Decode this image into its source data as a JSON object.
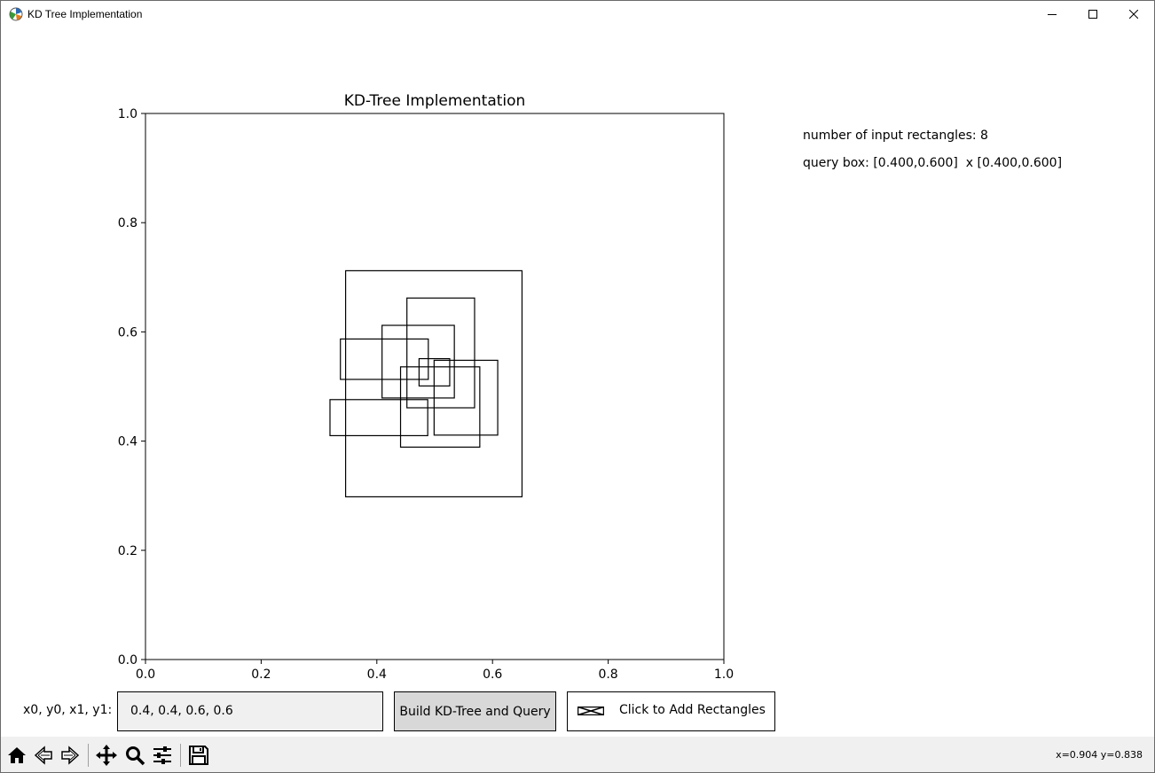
{
  "window": {
    "title": "KD Tree Implementation"
  },
  "info": {
    "num_rects": "number of input rectangles: 8",
    "query_box": "query box: [0.400,0.600]  x [0.400,0.600]"
  },
  "widgets": {
    "input_label": "x0, y0, x1, y1:",
    "input_value": "0.4, 0.4, 0.6, 0.6",
    "build_button": "Build KD-Tree and Query",
    "check_label": "Click to Add Rectangles"
  },
  "status": {
    "coords": "x=0.904 y=0.838"
  },
  "toolbar_icons": [
    "home-icon",
    "back-icon",
    "forward-icon",
    "pan-icon",
    "zoom-icon",
    "configure-subplots-icon",
    "save-icon"
  ],
  "chart_data": {
    "type": "rectangles",
    "title": "KD-Tree Implementation",
    "xlim": [
      0.0,
      1.0
    ],
    "ylim": [
      0.0,
      1.0
    ],
    "xticks": [
      "0.0",
      "0.2",
      "0.4",
      "0.6",
      "0.8",
      "1.0"
    ],
    "yticks": [
      "0.0",
      "0.2",
      "0.4",
      "0.6",
      "0.8",
      "1.0"
    ],
    "grid": false,
    "rectangles": [
      {
        "x0": 0.346,
        "y0": 0.298,
        "x1": 0.651,
        "y1": 0.712
      },
      {
        "x0": 0.452,
        "y0": 0.461,
        "x1": 0.569,
        "y1": 0.662
      },
      {
        "x0": 0.409,
        "y0": 0.479,
        "x1": 0.534,
        "y1": 0.612
      },
      {
        "x0": 0.337,
        "y0": 0.513,
        "x1": 0.489,
        "y1": 0.587
      },
      {
        "x0": 0.473,
        "y0": 0.501,
        "x1": 0.526,
        "y1": 0.551
      },
      {
        "x0": 0.499,
        "y0": 0.411,
        "x1": 0.609,
        "y1": 0.548
      },
      {
        "x0": 0.441,
        "y0": 0.389,
        "x1": 0.578,
        "y1": 0.536
      },
      {
        "x0": 0.319,
        "y0": 0.41,
        "x1": 0.488,
        "y1": 0.476
      }
    ]
  }
}
